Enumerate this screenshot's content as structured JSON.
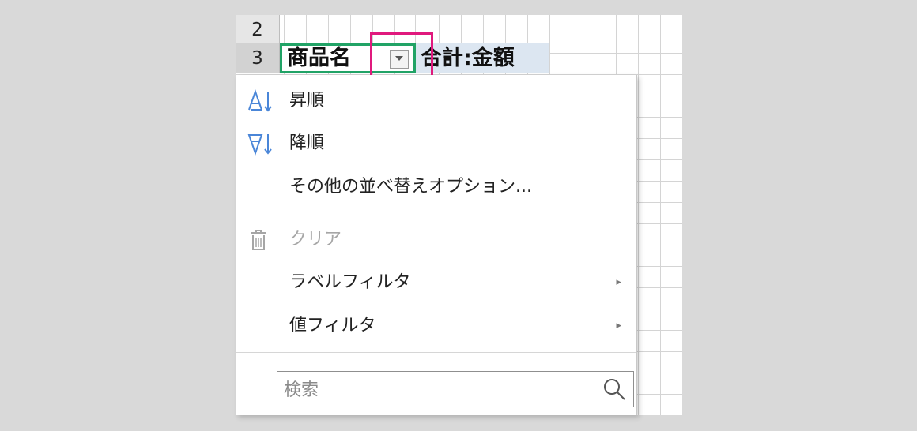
{
  "sheet": {
    "rows": [
      {
        "header": "2",
        "cells": [
          "",
          "",
          ""
        ]
      },
      {
        "header": "3",
        "cells": [
          "商品名",
          "合計:金額"
        ]
      }
    ]
  },
  "menu": {
    "sort_asc": "昇順",
    "sort_desc": "降順",
    "more_sort": "その他の並べ替えオプション...",
    "clear": "クリア",
    "label_filter": "ラベルフィルタ",
    "value_filter": "値フィルタ",
    "submenu_arrow": "▸"
  },
  "search": {
    "placeholder": "検索"
  },
  "colors": {
    "selection_border": "#21a366",
    "highlight": "#e0197d",
    "icon_blue": "#4a86d8",
    "header_fill": "#dce6f1"
  },
  "icons": {
    "sort_asc": "sort-ascending-icon",
    "sort_desc": "sort-descending-icon",
    "clear": "trash-icon",
    "search": "search-icon",
    "dropdown": "dropdown-arrow-icon"
  }
}
